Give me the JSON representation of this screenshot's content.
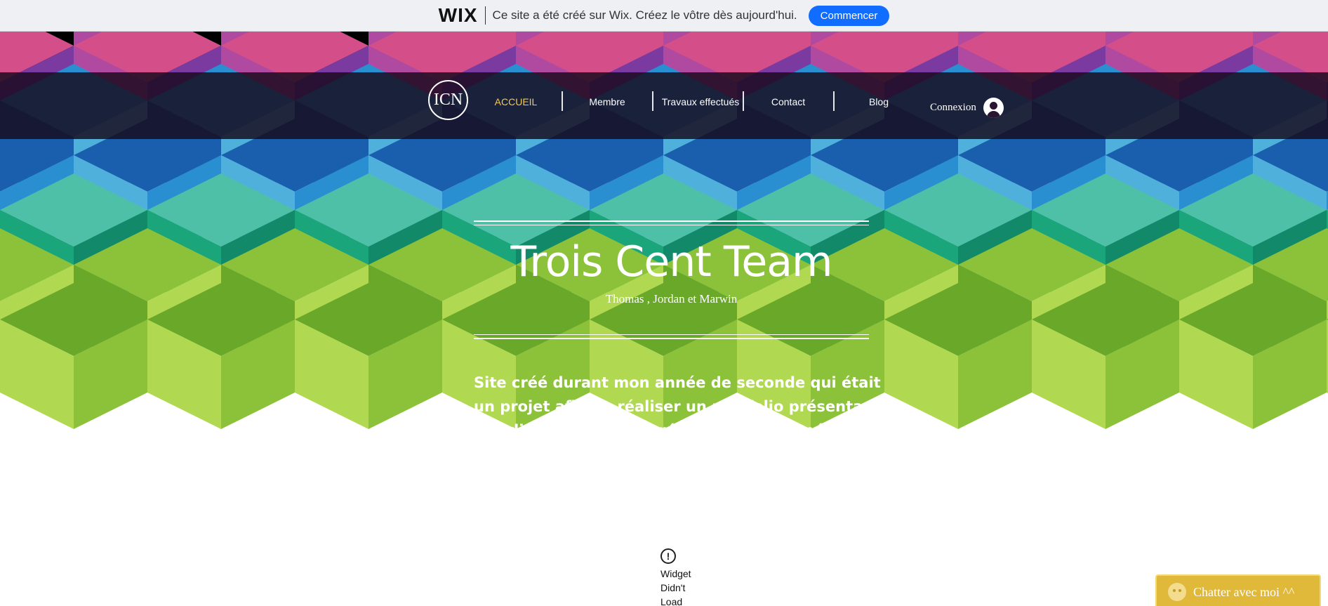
{
  "wix_banner": {
    "logo": "WIX",
    "message": "Ce site a été créé sur Wix. Créez le vôtre dès aujourd'hui.",
    "cta": "Commencer",
    "accent": "#116dff"
  },
  "site": {
    "logo_text": "ICN",
    "nav": [
      {
        "label": "ACCUEIL",
        "active": true
      },
      {
        "label": "Membre",
        "active": false
      },
      {
        "label": "Travaux effectués",
        "active": false
      },
      {
        "label": "Contact",
        "active": false
      },
      {
        "label": "Blog",
        "active": false
      }
    ],
    "login_label": "Connexion",
    "nav_active_color": "#f0c85a"
  },
  "hero": {
    "title": "Trois Cent Team",
    "subtitle": "Thomas , Jordan et Marwin",
    "description": "Site créé durant mon année de seconde qui était un projet afin de réaliser un portfolio présentant nos différents projets réalisés dans l'année scolaire."
  },
  "widget": {
    "icon": "warning-icon",
    "lines": [
      "Widget",
      "Didn't",
      "Load"
    ]
  },
  "chat": {
    "label": "Chatter avec moi ^^",
    "color": "#e0b83a"
  }
}
